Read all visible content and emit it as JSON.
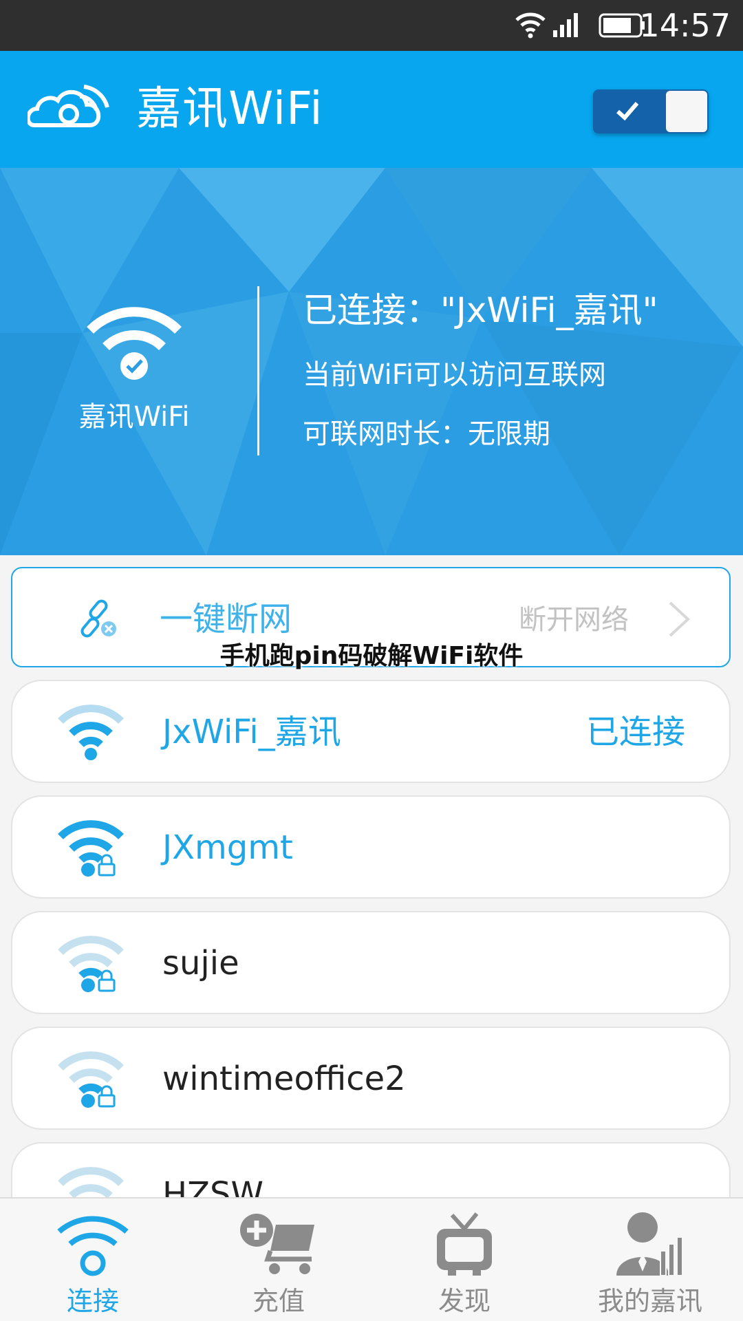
{
  "status_bar": {
    "time": "14:57"
  },
  "app_bar": {
    "title": "嘉讯WiFi",
    "toggle_on": true
  },
  "hero": {
    "network_name": "嘉讯WiFi",
    "connected_text": "已连接：\"JxWiFi_嘉讯\"",
    "internet_text": "当前WiFi可以访问互联网",
    "duration_text": "可联网时长：无限期"
  },
  "disconnect": {
    "label": "一键断网",
    "action": "断开网络"
  },
  "watermark": "手机跑pin码破解WiFi软件",
  "networks": [
    {
      "ssid": "JxWiFi_嘉讯",
      "status": "已连接",
      "locked": false,
      "highlight": true
    },
    {
      "ssid": "JXmgmt",
      "status": "",
      "locked": true,
      "highlight": true
    },
    {
      "ssid": "sujie",
      "status": "",
      "locked": true,
      "highlight": false
    },
    {
      "ssid": "wintimeoffice2",
      "status": "",
      "locked": true,
      "highlight": false
    },
    {
      "ssid": "HZSW",
      "status": "",
      "locked": false,
      "highlight": false
    }
  ],
  "nav": [
    {
      "label": "连接",
      "icon": "wifi-icon",
      "active": true
    },
    {
      "label": "充值",
      "icon": "cart-icon",
      "active": false
    },
    {
      "label": "发现",
      "icon": "tv-icon",
      "active": false
    },
    {
      "label": "我的嘉讯",
      "icon": "user-chart-icon",
      "active": false
    }
  ],
  "colors": {
    "primary": "#07a6ee",
    "accent": "#1ea6e6",
    "status_bar": "#2f2f2f",
    "toggle": "#1462aa"
  }
}
